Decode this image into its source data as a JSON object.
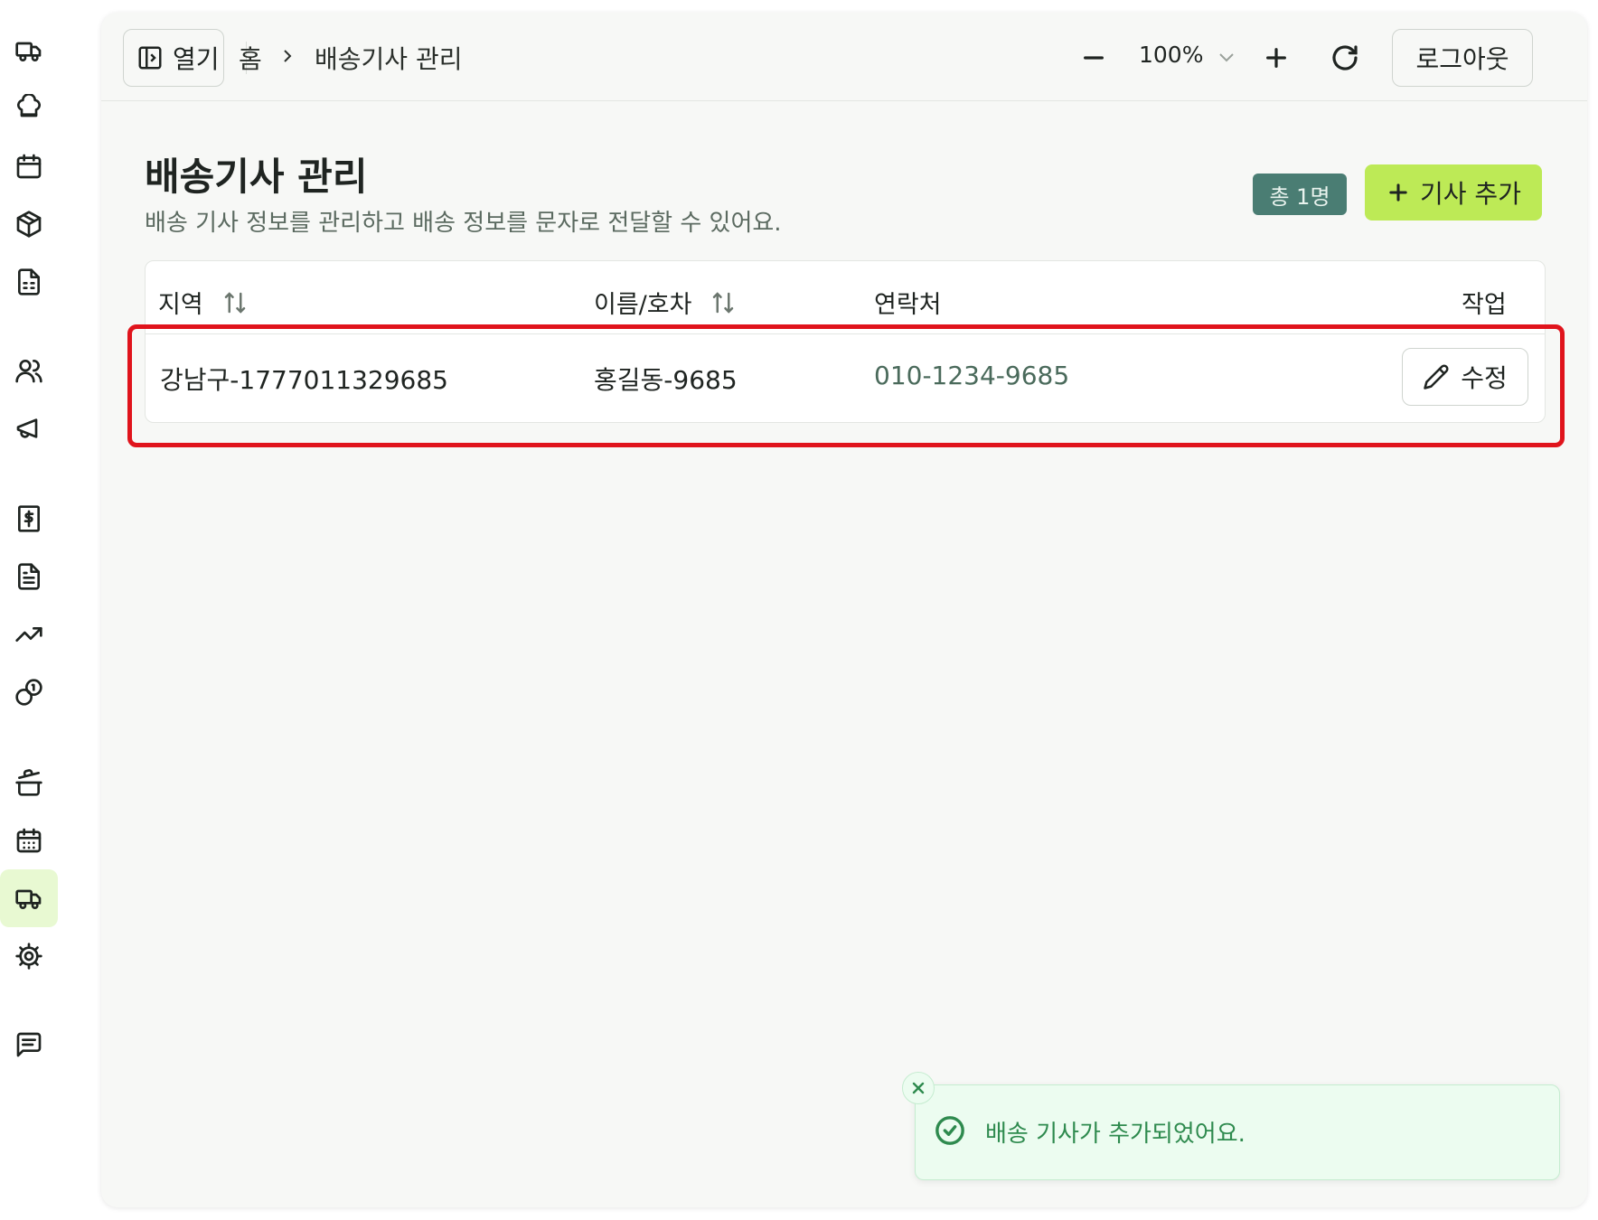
{
  "header": {
    "open_label": "열기",
    "breadcrumb_home": "홈",
    "breadcrumb_current": "배송기사 관리",
    "zoom_value": "100%",
    "logout_label": "로그아웃"
  },
  "page": {
    "title": "배송기사 관리",
    "subtitle": "배송 기사 정보를 관리하고 배송 정보를 문자로 전달할 수 있어요.",
    "count_badge": "총 1명",
    "add_button": "기사 추가"
  },
  "table": {
    "columns": [
      "지역",
      "이름/호차",
      "연락처",
      "작업"
    ],
    "rows": [
      {
        "region": "강남구-1777011329685",
        "name": "홍길동-9685",
        "phone": "010-1234-9685",
        "action": "수정"
      }
    ]
  },
  "toast": {
    "message": "배송 기사가 추가되었어요."
  },
  "sidebar": {
    "icons": [
      "truck-icon",
      "chef-hat-icon",
      "calendar-icon",
      "package-icon",
      "spreadsheet-icon",
      "users-icon",
      "megaphone-icon",
      "receipt-dollar-icon",
      "document-icon",
      "trending-up-icon",
      "coins-icon",
      "cooking-pot-icon",
      "calendar-grid-icon",
      "truck-icon",
      "settings-icon",
      "message-icon"
    ],
    "active": "truck-icon"
  },
  "colors": {
    "accent": "#bdea56",
    "badge": "#4a7d73",
    "highlight": "#e0141c",
    "success": "#2e8a4e"
  }
}
